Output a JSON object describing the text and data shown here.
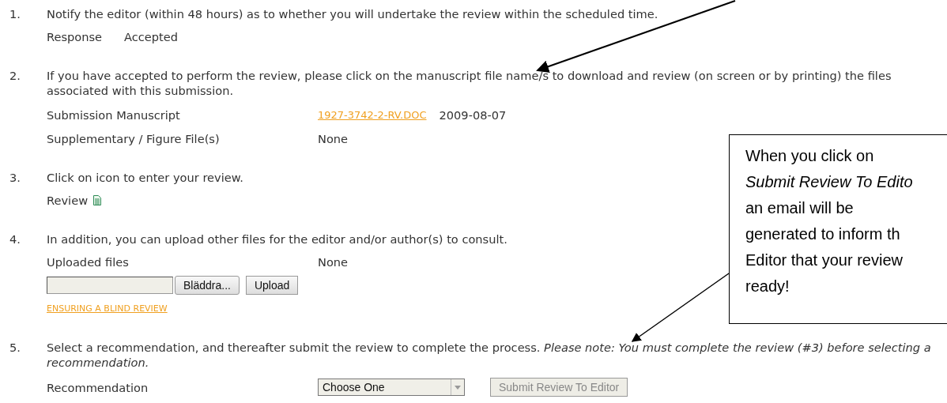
{
  "steps": [
    {
      "number": "1.",
      "text": "Notify the editor (within 48 hours) as to whether you will undertake the review within the scheduled time.",
      "response": {
        "label": "Response",
        "value": "Accepted"
      }
    },
    {
      "number": "2.",
      "text": "If you have accepted to perform the review, please click on the manuscript file name/s to download and review (on screen or by printing) the files associated with this submission.",
      "files": [
        {
          "label": "Submission Manuscript",
          "link": "1927-3742-2-RV.DOC",
          "date": "2009-08-07"
        },
        {
          "label": "Supplementary / Figure File(s)",
          "value": "None"
        }
      ]
    },
    {
      "number": "3.",
      "text": "Click on icon to enter your review.",
      "review": {
        "label": "Review"
      }
    },
    {
      "number": "4.",
      "text": "In addition, you can upload other files for the editor and/or author(s) to consult.",
      "uploaded": {
        "label": "Uploaded files",
        "value": "None"
      },
      "upload": {
        "browse_button": "Bläddra...",
        "upload_button": "Upload"
      },
      "link": "ENSURING A BLIND REVIEW"
    },
    {
      "number": "5.",
      "text": "Select a recommendation, and thereafter submit the review to complete the process. *Please note: You must complete the review (#3) before selecting a recommendation.*",
      "recommendation": {
        "label": "Recommendation",
        "select_value": "Choose One",
        "submit_button": "Submit Review To Editor",
        "disabled": true
      }
    }
  ],
  "callout": {
    "lines": [
      {
        "text": "When you click on",
        "italic": false
      },
      {
        "text": "Submit Review To Edito",
        "italic": true
      },
      {
        "text": "an email will be",
        "italic": false
      },
      {
        "text": "generated to inform th",
        "italic": false
      },
      {
        "text": "Editor that your review",
        "italic": false
      },
      {
        "text": "ready!",
        "italic": false
      }
    ]
  }
}
